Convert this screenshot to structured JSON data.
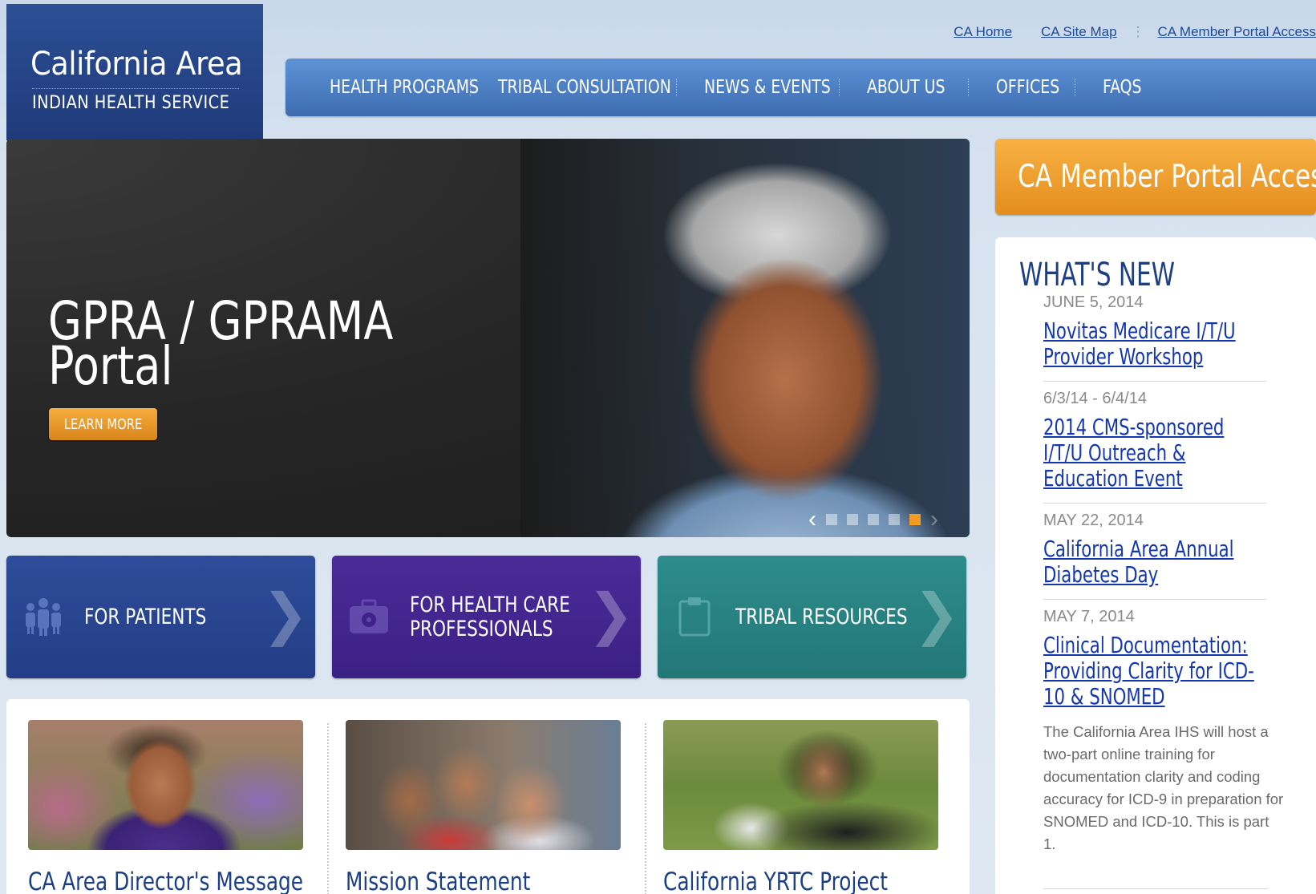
{
  "logo": {
    "title": "California Area",
    "subtitle": "INDIAN HEALTH SERVICE"
  },
  "utility_links": [
    "CA Home",
    "CA Site Map",
    "CA Member Portal Access"
  ],
  "nav": [
    "HEALTH PROGRAMS",
    "TRIBAL CONSULTATION",
    "NEWS & EVENTS",
    "ABOUT US",
    "OFFICES",
    "FAQS"
  ],
  "hero": {
    "title": "GPRA / GPRAMA\nPortal",
    "button": "LEARN MORE",
    "slides_total": 5,
    "active_slide": 5
  },
  "tiles": [
    {
      "label": "FOR PATIENTS",
      "icon": "people-icon"
    },
    {
      "label": "FOR HEALTH CARE\nPROFESSIONALS",
      "icon": "medical-bag-icon"
    },
    {
      "label": "TRIBAL RESOURCES",
      "icon": "clipboard-icon"
    }
  ],
  "cards": [
    {
      "title": "CA Area Director's Message"
    },
    {
      "title": "Mission Statement"
    },
    {
      "title": "California YRTC Project"
    }
  ],
  "portal_button": "CA Member Portal Access",
  "whats_new": {
    "heading": "WHAT'S NEW",
    "items": [
      {
        "date": "JUNE 5, 2014",
        "title": "Novitas Medicare I/T/U Provider Workshop"
      },
      {
        "date": "6/3/14 - 6/4/14",
        "title": "2014 CMS-sponsored I/T/U Outreach & Education Event"
      },
      {
        "date": "MAY 22, 2014",
        "title": "California Area Annual Diabetes Day"
      },
      {
        "date": "MAY 7, 2014",
        "title": "Clinical Documentation: Providing Clarity for ICD-10 & SNOMED",
        "description": "The California Area IHS will host a two-part online training for documentation clarity and coding accuracy for ICD-9 in preparation for SNOMED and ICD-10.  This is part 1."
      }
    ]
  },
  "colors": {
    "brand_blue": "#1e3a7a",
    "nav_blue": "#4a7cc2",
    "accent_orange": "#f39c22",
    "link": "#1437b0"
  }
}
